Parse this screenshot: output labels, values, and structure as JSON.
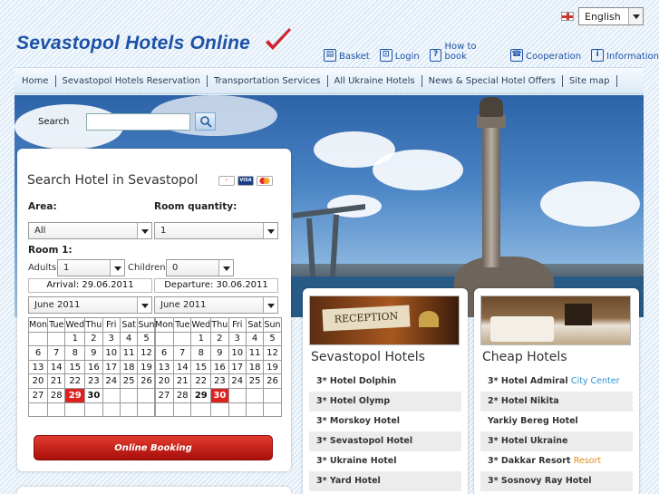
{
  "language": {
    "selected": "English"
  },
  "brand": {
    "logo": "Sevastopol Hotels Online"
  },
  "toplinks": [
    {
      "label": "Basket",
      "icon": "basket-icon",
      "glyph": "▤"
    },
    {
      "label": "Login",
      "icon": "login-icon",
      "glyph": "⊡"
    },
    {
      "label": "How to book",
      "icon": "help-icon",
      "glyph": "?"
    },
    {
      "label": "Cooperation",
      "icon": "phone-icon",
      "glyph": "☎"
    },
    {
      "label": "Information",
      "icon": "info-icon",
      "glyph": "i"
    }
  ],
  "nav": [
    "Home",
    "Sevastopol Hotels Reservation",
    "Transportation Services",
    "All Ukraine Hotels",
    "News & Special Hotel Offers",
    "Site map"
  ],
  "search": {
    "label": "Search",
    "value": ""
  },
  "booking": {
    "title": "Search Hotel in Sevastopol",
    "area_label": "Area:",
    "area_value": "All",
    "room_qty_label": "Room quantity:",
    "room_qty_value": "1",
    "room_label": "Room 1:",
    "adults_label": "Adults:",
    "adults_value": "1",
    "children_label": "Children:",
    "children_value": "0",
    "arrival": "Arrival: 29.06.2011",
    "departure": "Departure: 30.06.2011",
    "arrival_month": "June 2011",
    "departure_month": "June 2011",
    "weekdays": [
      "Mon",
      "Tue",
      "Wed",
      "Thu",
      "Fri",
      "Sat",
      "Sun"
    ],
    "weeks": [
      [
        "",
        "",
        "1",
        "2",
        "3",
        "4",
        "5"
      ],
      [
        "6",
        "7",
        "8",
        "9",
        "10",
        "11",
        "12"
      ],
      [
        "13",
        "14",
        "15",
        "16",
        "17",
        "18",
        "19"
      ],
      [
        "20",
        "21",
        "22",
        "23",
        "24",
        "25",
        "26"
      ],
      [
        "27",
        "28",
        "29",
        "30",
        "",
        "",
        ""
      ],
      [
        "",
        "",
        "",
        "",
        "",
        "",
        ""
      ]
    ],
    "arrival_day": "29",
    "departure_day": "30",
    "button": "Online Booking"
  },
  "sevastopol_hotels": {
    "title": "Sevastopol Hotels",
    "photo_sign": "RECEPTION",
    "items": [
      {
        "name": "3* Hotel Dolphin"
      },
      {
        "name": "3* Hotel Olymp"
      },
      {
        "name": "3* Morskoy Hotel"
      },
      {
        "name": "3* Sevastopol Hotel"
      },
      {
        "name": "3* Ukraine Hotel"
      },
      {
        "name": "3* Yard Hotel"
      }
    ]
  },
  "cheap_hotels": {
    "title": "Cheap Hotels",
    "items": [
      {
        "name": "3* Hotel Admiral",
        "tag": "City Center",
        "tag_color": "blue"
      },
      {
        "name": "2* Hotel Nikita"
      },
      {
        "name": "Yarkiy Bereg Hotel"
      },
      {
        "name": "3* Hotel Ukraine"
      },
      {
        "name": "3* Dakkar Resort",
        "tag": "Resort",
        "tag_color": "orange"
      },
      {
        "name": "3* Sosnovy Ray Hotel"
      }
    ]
  },
  "colors": {
    "brand": "#1d52a8",
    "highlight": "#dd2222",
    "button": "#c8241b"
  }
}
